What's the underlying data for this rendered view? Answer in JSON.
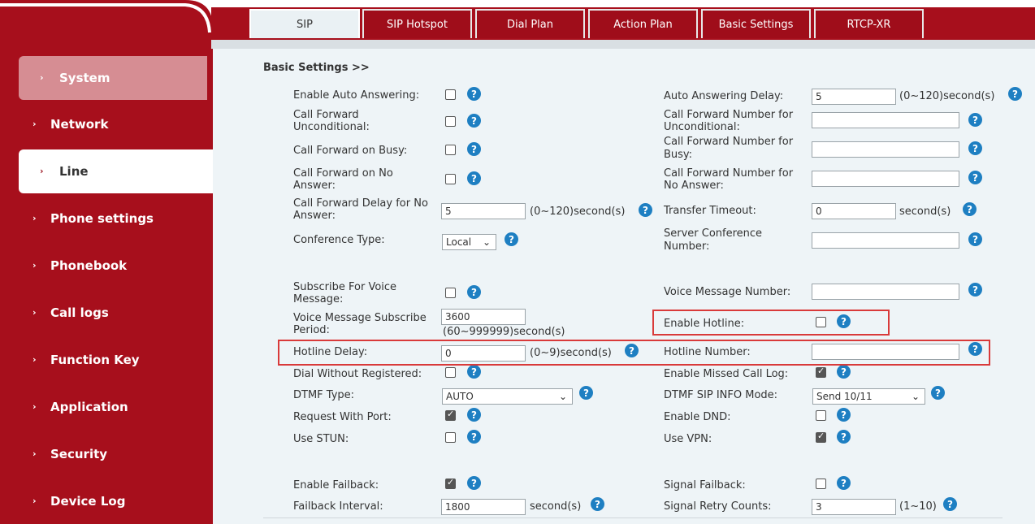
{
  "sidebar": {
    "items": [
      {
        "label": "System"
      },
      {
        "label": "Network"
      },
      {
        "label": "Line"
      },
      {
        "label": "Phone settings"
      },
      {
        "label": "Phonebook"
      },
      {
        "label": "Call logs"
      },
      {
        "label": "Function Key"
      },
      {
        "label": "Application"
      },
      {
        "label": "Security"
      },
      {
        "label": "Device Log"
      }
    ]
  },
  "tabs": [
    {
      "label": "SIP"
    },
    {
      "label": "SIP Hotspot"
    },
    {
      "label": "Dial Plan"
    },
    {
      "label": "Action Plan"
    },
    {
      "label": "Basic Settings"
    },
    {
      "label": "RTCP-XR"
    }
  ],
  "section_title": "Basic Settings >>",
  "help_glyph": "?",
  "left": {
    "enable_auto_answering": {
      "label": "Enable Auto Answering:",
      "checked": false
    },
    "cf_unconditional": {
      "label1": "Call Forward",
      "label2": "Unconditional:",
      "checked": false
    },
    "cf_busy": {
      "label": "Call Forward on Busy:",
      "checked": false
    },
    "cf_no_answer": {
      "label1": "Call Forward on No",
      "label2": "Answer:",
      "checked": false
    },
    "cf_delay": {
      "label1": "Call Forward Delay for No",
      "label2": "Answer:",
      "value": "5",
      "unit": "(0~120)second(s)"
    },
    "conference_type": {
      "label": "Conference Type:",
      "value": "Local"
    },
    "subscribe_voice": {
      "label1": "Subscribe For Voice",
      "label2": "Message:",
      "checked": false
    },
    "vm_subscribe_period": {
      "label1": "Voice Message Subscribe",
      "label2": "Period:",
      "value": "3600",
      "unit": "(60~999999)second(s)"
    },
    "hotline_delay": {
      "label": "Hotline Delay:",
      "value": "0",
      "unit": "(0~9)second(s)"
    },
    "dial_without_registered": {
      "label": "Dial Without Registered:",
      "checked": false
    },
    "dtmf_type": {
      "label": "DTMF Type:",
      "value": "AUTO"
    },
    "request_with_port": {
      "label": "Request With Port:",
      "checked": true
    },
    "use_stun": {
      "label": "Use STUN:",
      "checked": false
    },
    "enable_failback": {
      "label": "Enable Failback:",
      "checked": true
    },
    "failback_interval": {
      "label": "Failback Interval:",
      "value": "1800",
      "unit": "second(s)"
    }
  },
  "right": {
    "auto_answering_delay": {
      "label": "Auto Answering Delay:",
      "value": "5",
      "unit": "(0~120)second(s)"
    },
    "cf_number_unconditional": {
      "label1": "Call Forward Number for",
      "label2": "Unconditional:",
      "value": ""
    },
    "cf_number_busy": {
      "label1": "Call Forward Number for",
      "label2": "Busy:",
      "value": ""
    },
    "cf_number_no_answer": {
      "label1": "Call Forward Number for",
      "label2": "No Answer:",
      "value": ""
    },
    "transfer_timeout": {
      "label": "Transfer Timeout:",
      "value": "0",
      "unit": "second(s)"
    },
    "server_conference_number": {
      "label1": "Server Conference",
      "label2": "Number:",
      "value": ""
    },
    "voice_message_number": {
      "label": "Voice Message Number:",
      "value": ""
    },
    "enable_hotline": {
      "label": "Enable Hotline:",
      "checked": false
    },
    "hotline_number": {
      "label": "Hotline Number:",
      "value": ""
    },
    "enable_missed_call_log": {
      "label": "Enable Missed Call Log:",
      "checked": true
    },
    "dtmf_sip_info_mode": {
      "label": "DTMF SIP INFO Mode:",
      "value": "Send 10/11"
    },
    "enable_dnd": {
      "label": "Enable DND:",
      "checked": false
    },
    "use_vpn": {
      "label": "Use VPN:",
      "checked": true
    },
    "signal_failback": {
      "label": "Signal Failback:",
      "checked": false
    },
    "signal_retry_counts": {
      "label": "Signal Retry Counts:",
      "value": "3",
      "unit": "(1~10)"
    }
  },
  "colors": {
    "brand_red": "#a70f1c",
    "highlight": "#d93a3a",
    "help_blue": "#1e7fc2",
    "content_bg": "#eef4f7"
  }
}
